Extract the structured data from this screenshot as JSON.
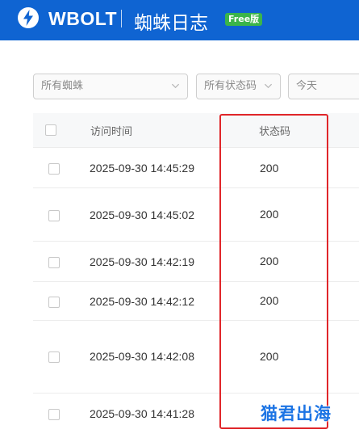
{
  "header": {
    "brand": "WBOLT",
    "title": "蜘蛛日志",
    "badge": "Free版",
    "bg_color": "#0f64d2"
  },
  "filters": {
    "spider": "所有蜘蛛",
    "status": "所有状态码",
    "date": "今天"
  },
  "table": {
    "columns": {
      "time": "访问时间",
      "status": "状态码"
    },
    "rows": [
      {
        "time": "2025-09-30 14:45:29",
        "status": "200"
      },
      {
        "time": "2025-09-30 14:45:02",
        "status": "200"
      },
      {
        "time": "2025-09-30 14:42:19",
        "status": "200"
      },
      {
        "time": "2025-09-30 14:42:12",
        "status": "200"
      },
      {
        "time": "2025-09-30 14:42:08",
        "status": "200"
      },
      {
        "time": "2025-09-30 14:41:28",
        "status": ""
      }
    ]
  },
  "watermark": "猫君出海",
  "highlight_color": "#e0262a"
}
